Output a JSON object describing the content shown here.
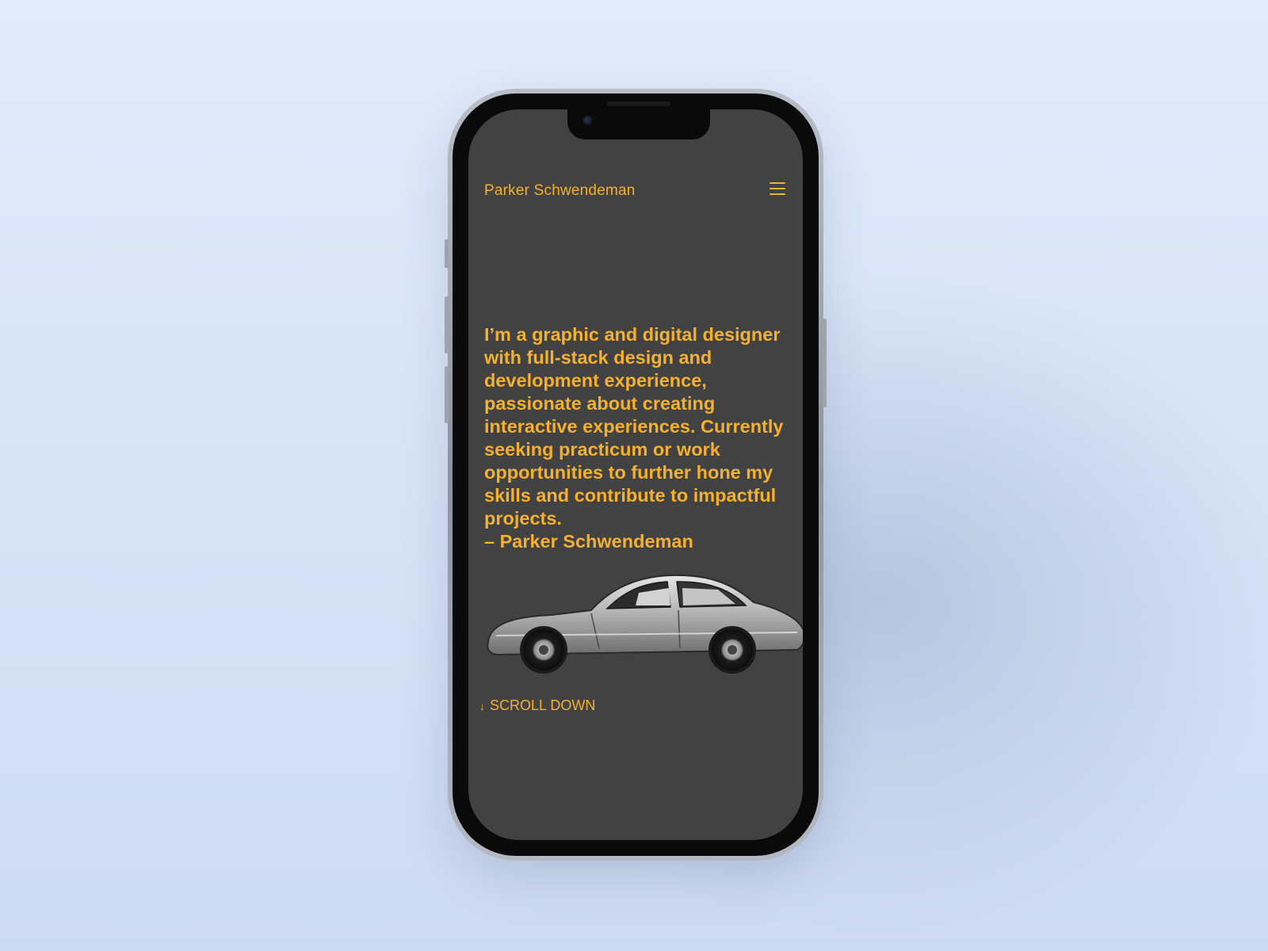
{
  "site": {
    "title": "Parker Schwendeman"
  },
  "hero": {
    "intro_text": "I’m a graphic and digital designer with full-stack design and development experience, passionate about creating interactive experiences. Currently seeking practicum or work opportunities to further hone my skills and contribute to impactful projects.",
    "author_line": "– Parker Schwendeman"
  },
  "scroll": {
    "label": "SCROLL DOWN",
    "icon": "arrow-down-icon"
  },
  "icons": {
    "menu": "hamburger-menu-icon",
    "car": "car-illustration"
  },
  "colors": {
    "accent": "#f5b02e",
    "screen_background": "#424242",
    "page_background": "#dce6f8"
  }
}
